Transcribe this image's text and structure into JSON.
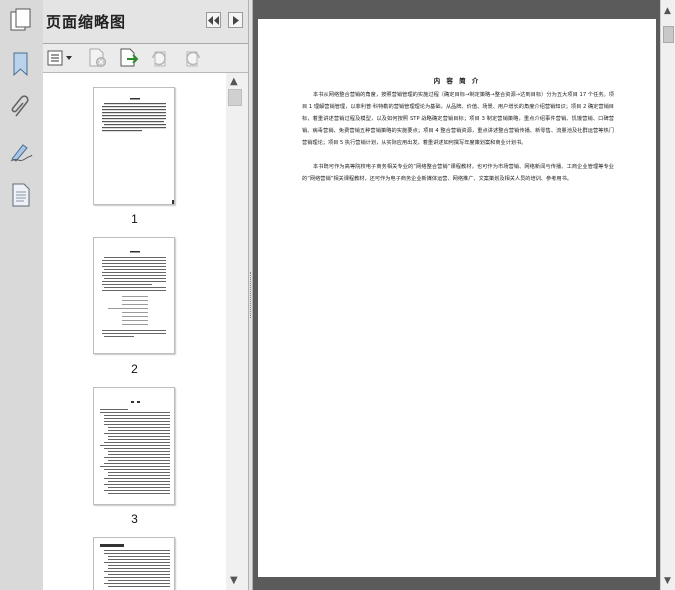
{
  "panel": {
    "title": "页面缩略图"
  },
  "thumbnails": [
    {
      "label": "1"
    },
    {
      "label": "2"
    },
    {
      "label": "3"
    },
    {
      "label": ""
    }
  ],
  "page": {
    "title": "内 容 简 介",
    "paragraphs": [
      "本书从网络整合营销的角度，按照营销管理的实施过程（确定目标→制定策略→整合资源→达到目标）分为五大项目 17 个任务。项目 1 理解营销管理，以菲利普·科特勒的营销管理理论为基础，从品牌、价值、场景、用户增长的角度介绍营销知识；项目 2 确定营销目标，着重讲述营销过程及模型，以及如何按照 STP 战略确定营销目标；项目 3 制定营销策略，重点介绍事件营销、饥饿营销、口碑营销、病毒营销、免费营销五种营销策略的实施要点；项目 4 整合营销资源，重点讲述整合营销传播、新零售、流量池及社群运营等热门营销理论；项目 5 执行营销计划，从实际应用出发，着重讲述如何撰写年度策划案和商业计划书。",
      "本书既可作为高等院校电子商务相关专业的“网络整合营销”课程教材，也可作为市场营销、网络新闻与传播、工商企业管理等专业的“网络营销”相关课程教材，还可作为电子商务企业新媒体运营、网络推广、文案策划及相关人员的培训、参考用书。"
    ]
  },
  "colors": {
    "docBackground": "#5b5b5b",
    "panelBackground": "#f0f0f0",
    "rail": "#d9d9d9"
  },
  "icons": [
    "pages-icon",
    "bookmark-icon",
    "attachment-icon",
    "signature-icon",
    "page-thumbnail-icon",
    "options-menu-icon",
    "delete-page-icon",
    "replace-page-icon",
    "rotate-ccw-icon",
    "rotate-cw-icon",
    "collapse-panel-icon",
    "next-icon"
  ]
}
